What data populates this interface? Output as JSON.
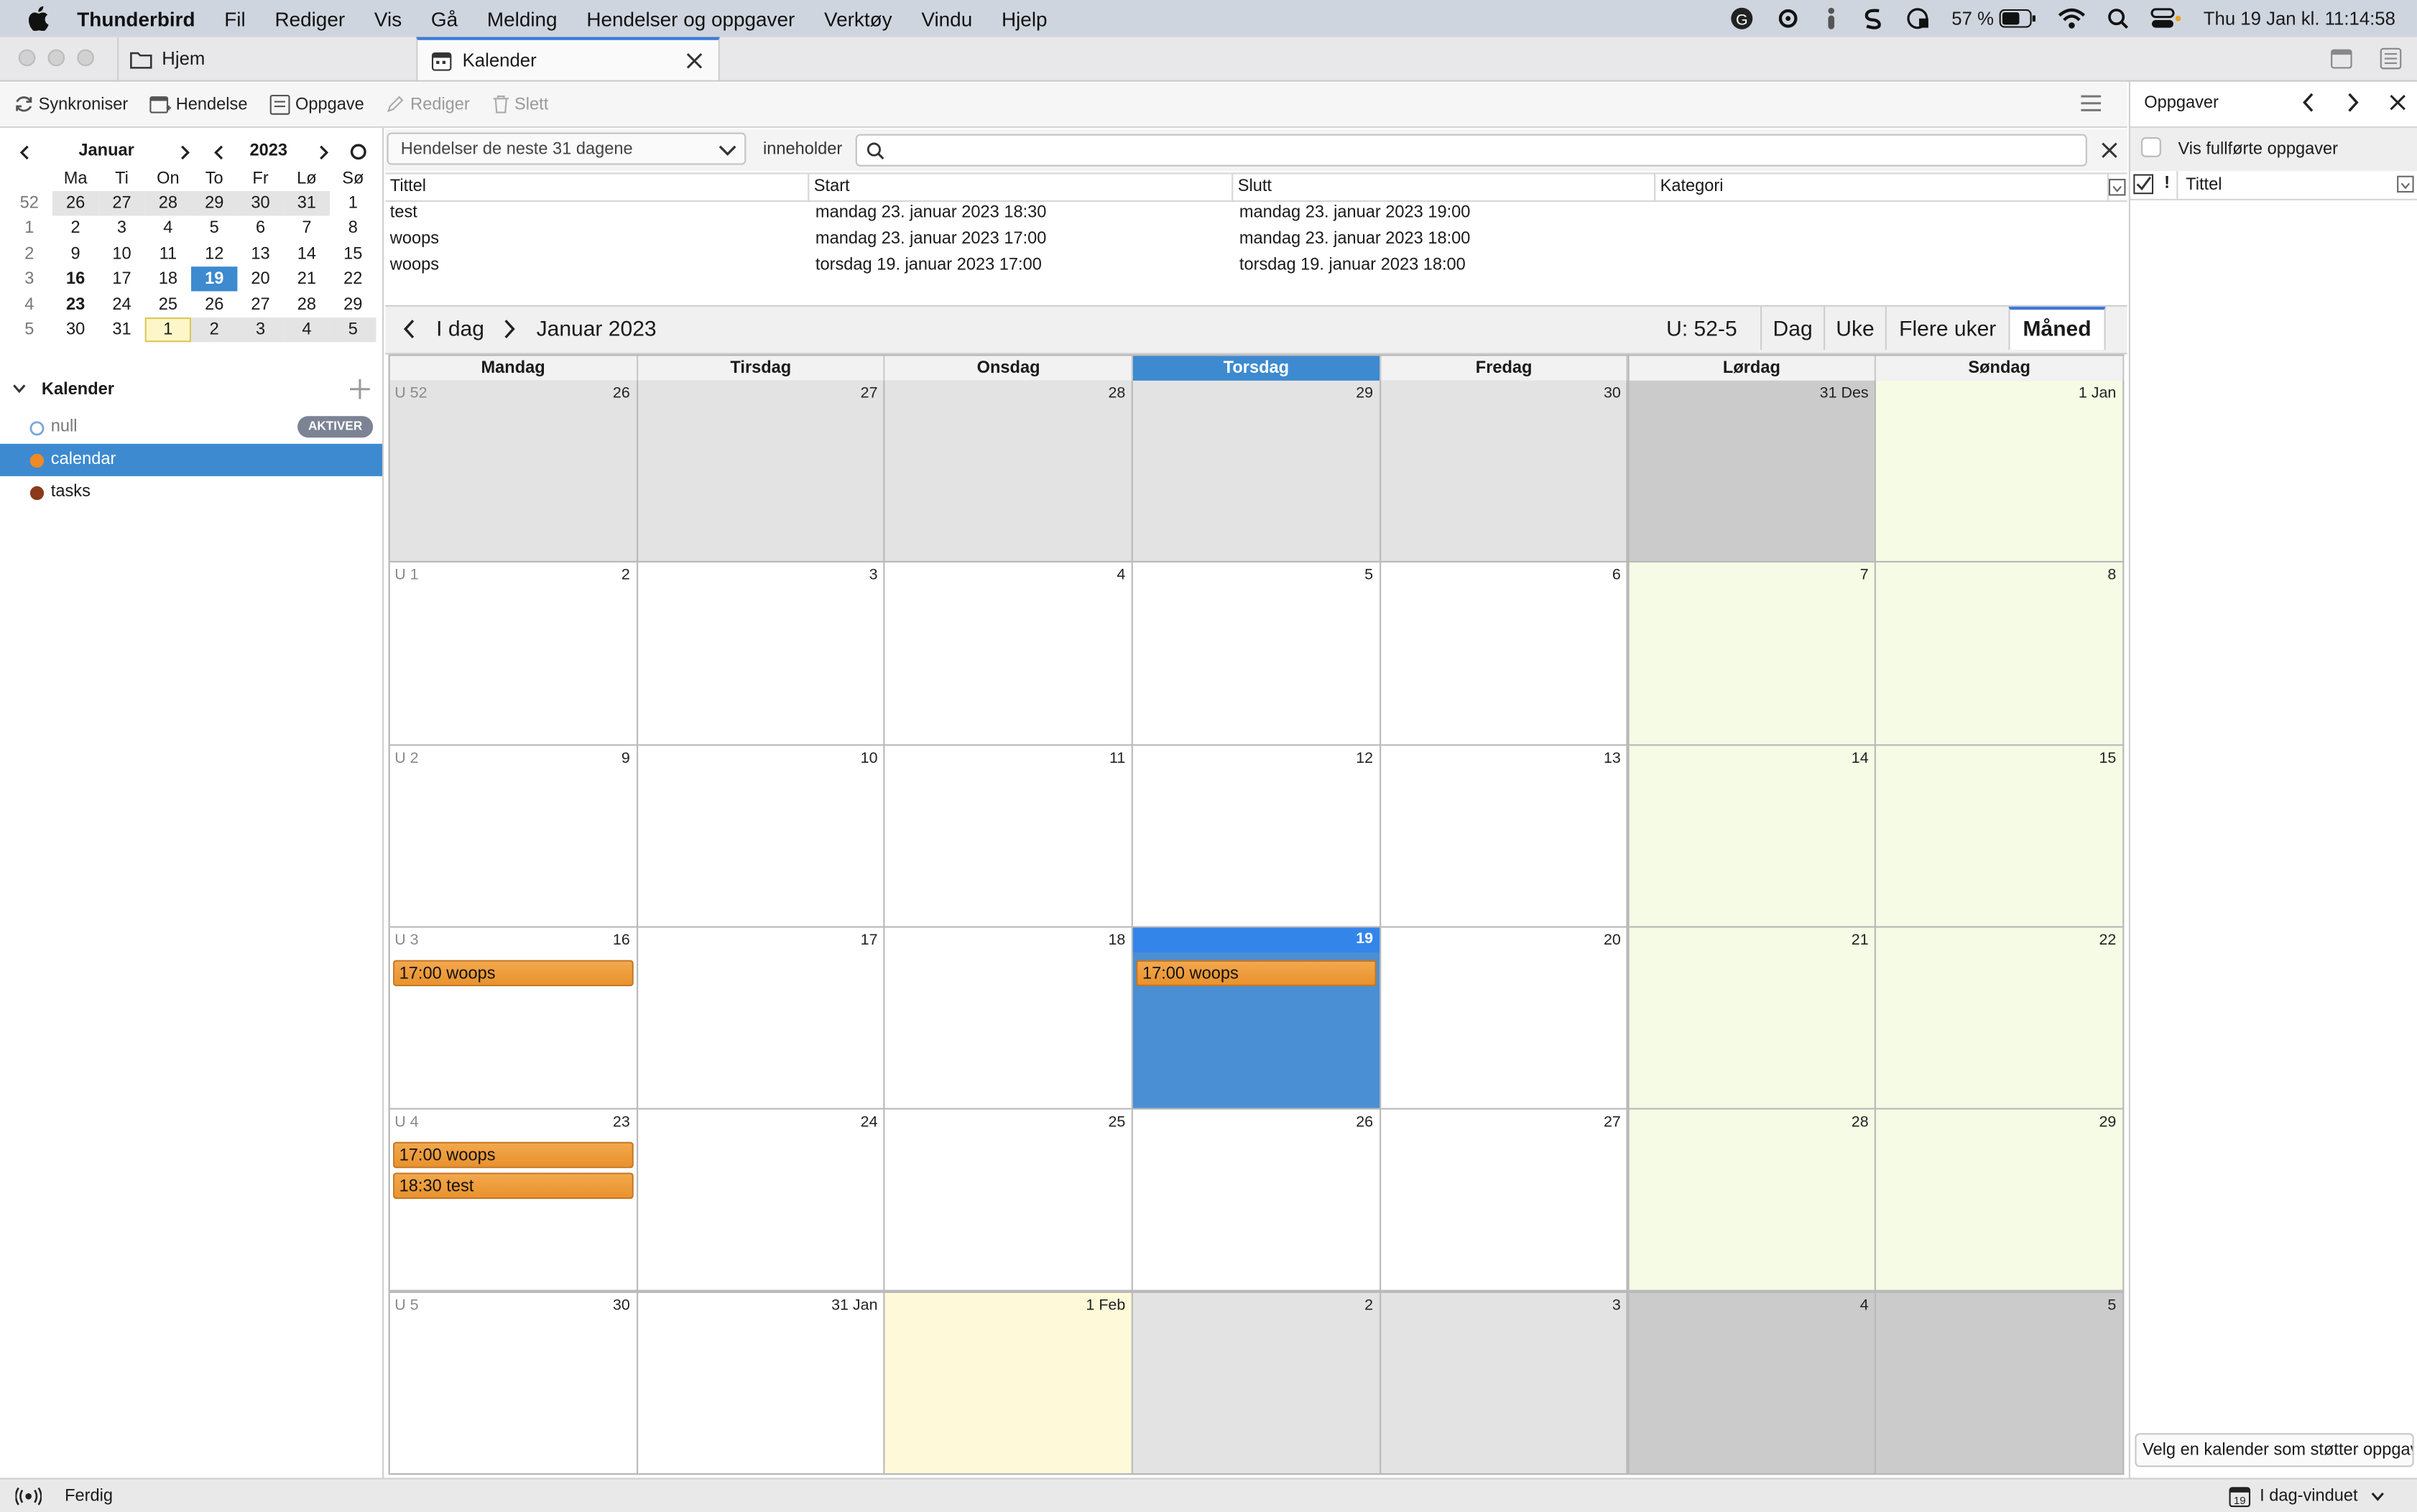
{
  "menubar": {
    "app": "Thunderbird",
    "items": [
      "Fil",
      "Rediger",
      "Vis",
      "Gå",
      "Melding",
      "Hendelser og oppgaver",
      "Verktøy",
      "Vindu",
      "Hjelp"
    ],
    "battery": "57 %",
    "clock": "Thu 19 Jan kl. 11:14:58"
  },
  "tabs": [
    {
      "label": "Hjem",
      "icon": "folder-icon"
    },
    {
      "label": "Kalender",
      "icon": "calendar-icon"
    }
  ],
  "toolbar": {
    "sync": "Synkroniser",
    "event": "Hendelse",
    "task": "Oppgave",
    "edit": "Rediger",
    "delete": "Slett"
  },
  "minical": {
    "month": "Januar",
    "year": "2023",
    "weekday_headers": [
      "Ma",
      "Ti",
      "On",
      "To",
      "Fr",
      "Lø",
      "Sø"
    ],
    "weeks": [
      {
        "wk": "52",
        "days": [
          "26",
          "27",
          "28",
          "29",
          "30",
          "31",
          "1"
        ]
      },
      {
        "wk": "1",
        "days": [
          "2",
          "3",
          "4",
          "5",
          "6",
          "7",
          "8"
        ]
      },
      {
        "wk": "2",
        "days": [
          "9",
          "10",
          "11",
          "12",
          "13",
          "14",
          "15"
        ]
      },
      {
        "wk": "3",
        "days": [
          "16",
          "17",
          "18",
          "19",
          "20",
          "21",
          "22"
        ]
      },
      {
        "wk": "4",
        "days": [
          "23",
          "24",
          "25",
          "26",
          "27",
          "28",
          "29"
        ]
      },
      {
        "wk": "5",
        "days": [
          "30",
          "31",
          "1",
          "2",
          "3",
          "4",
          "5"
        ]
      }
    ]
  },
  "calendars": {
    "header": "Kalender",
    "items": [
      {
        "name": "null",
        "badge": "AKTIVER",
        "color": "#ffffff"
      },
      {
        "name": "calendar",
        "color": "#f08a24"
      },
      {
        "name": "tasks",
        "color": "#8a3a1a"
      }
    ]
  },
  "filter": {
    "select_value": "Hendelser de neste 31 dagene",
    "contains_label": "inneholder",
    "search_value": ""
  },
  "event_list": {
    "columns": [
      "Tittel",
      "Start",
      "Slutt",
      "Kategori"
    ],
    "rows": [
      {
        "title": "test",
        "start": "mandag 23. januar 2023 18:30",
        "end": "mandag 23. januar 2023 19:00",
        "category": ""
      },
      {
        "title": "woops",
        "start": "mandag 23. januar 2023 17:00",
        "end": "mandag 23. januar 2023 18:00",
        "category": ""
      },
      {
        "title": "woops",
        "start": "torsdag 19. januar 2023 17:00",
        "end": "torsdag 19. januar 2023 18:00",
        "category": ""
      }
    ]
  },
  "nav": {
    "today": "I dag",
    "period": "Januar 2023",
    "week_range": "U: 52-5",
    "views": [
      "Dag",
      "Uke",
      "Flere uker",
      "Måned"
    ],
    "active_view": "Måned"
  },
  "month_grid": {
    "day_headers": [
      "Mandag",
      "Tirsdag",
      "Onsdag",
      "Torsdag",
      "Fredag",
      "Lørdag",
      "Søndag"
    ],
    "today_column": 3,
    "weeks": [
      {
        "label": "U 52",
        "days": [
          "26",
          "27",
          "28",
          "29",
          "30",
          "31 Des",
          "1 Jan"
        ]
      },
      {
        "label": "U 1",
        "days": [
          "2",
          "3",
          "4",
          "5",
          "6",
          "7",
          "8"
        ]
      },
      {
        "label": "U 2",
        "days": [
          "9",
          "10",
          "11",
          "12",
          "13",
          "14",
          "15"
        ]
      },
      {
        "label": "U 3",
        "days": [
          "16",
          "17",
          "18",
          "19",
          "20",
          "21",
          "22"
        ]
      },
      {
        "label": "U 4",
        "days": [
          "23",
          "24",
          "25",
          "26",
          "27",
          "28",
          "29"
        ]
      },
      {
        "label": "U 5",
        "days": [
          "30",
          "31 Jan",
          "1 Feb",
          "2",
          "3",
          "4",
          "5"
        ]
      }
    ],
    "events": [
      {
        "week": 3,
        "day": 0,
        "slot": 0,
        "text": "17:00 woops"
      },
      {
        "week": 3,
        "day": 3,
        "slot": 0,
        "text": "17:00 woops"
      },
      {
        "week": 4,
        "day": 0,
        "slot": 0,
        "text": "17:00 woops"
      },
      {
        "week": 4,
        "day": 0,
        "slot": 1,
        "text": "18:30 test"
      }
    ]
  },
  "tasks_pane": {
    "title": "Oppgaver",
    "show_completed": "Vis fullførte oppgaver",
    "col_priority": "!",
    "col_title": "Tittel",
    "footer": "Velg en kalender som støtter oppgaver"
  },
  "statusbar": {
    "status": "Ferdig",
    "today_pane": "I dag-vinduet"
  }
}
